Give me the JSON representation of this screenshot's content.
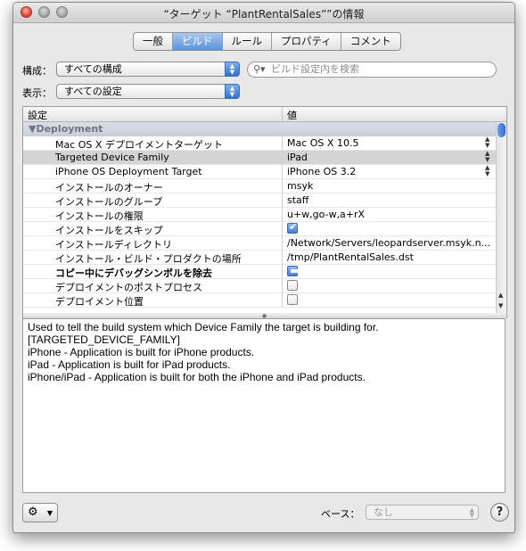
{
  "window": {
    "title": "“ターゲット “PlantRentalSales””の情報"
  },
  "tabs": [
    {
      "label": "一般"
    },
    {
      "label": "ビルド",
      "active": true
    },
    {
      "label": "ルール"
    },
    {
      "label": "プロパティ"
    },
    {
      "label": "コメント"
    }
  ],
  "config": {
    "label": "構成：",
    "value": "すべての構成"
  },
  "show": {
    "label": "表示：",
    "value": "すべての設定"
  },
  "search": {
    "placeholder": "ビルド設定内を検索"
  },
  "table": {
    "col_setting": "設定",
    "col_value": "値",
    "group": "▼Deployment",
    "rows": [
      {
        "name": "Mac OS X デプロイメントターゲット",
        "value": "Mac OS X 10.5"
      },
      {
        "name": "Targeted Device Family",
        "value": "iPad"
      },
      {
        "name": "iPhone OS Deployment Target",
        "value": "iPhone OS 3.2"
      },
      {
        "name": "インストールのオーナー",
        "value": "msyk"
      },
      {
        "name": "インストールのグループ",
        "value": "staff"
      },
      {
        "name": "インストールの権限",
        "value": "u+w,go-w,a+rX"
      },
      {
        "name": "インストールをスキップ",
        "checkbox": "checked"
      },
      {
        "name": "インストールディレクトリ",
        "value": "/Network/Servers/leopardserver.msyk.n..."
      },
      {
        "name": "インストール・ビルド・プロダクトの場所",
        "value": "/tmp/PlantRentalSales.dst"
      },
      {
        "name": "コピー中にデバッグシンボルを除去",
        "checkbox": "mixed"
      },
      {
        "name": "デプロイメントのポストプロセス",
        "checkbox": "unchecked"
      },
      {
        "name": "デプロイメント位置",
        "checkbox": "unchecked"
      }
    ]
  },
  "description": {
    "line1": "Used to tell the build system which Device Family the target is building for.",
    "line2": "[TARGETED_DEVICE_FAMILY]",
    "line3": "",
    "line4": "iPhone - Application is built for iPhone products.",
    "line5": "iPad - Application is built for iPad products.",
    "line6": "iPhone/iPad - Application is built for both the iPhone and iPad products."
  },
  "footer": {
    "base_label": "ベース：",
    "base_value": "なし",
    "help": "?"
  }
}
